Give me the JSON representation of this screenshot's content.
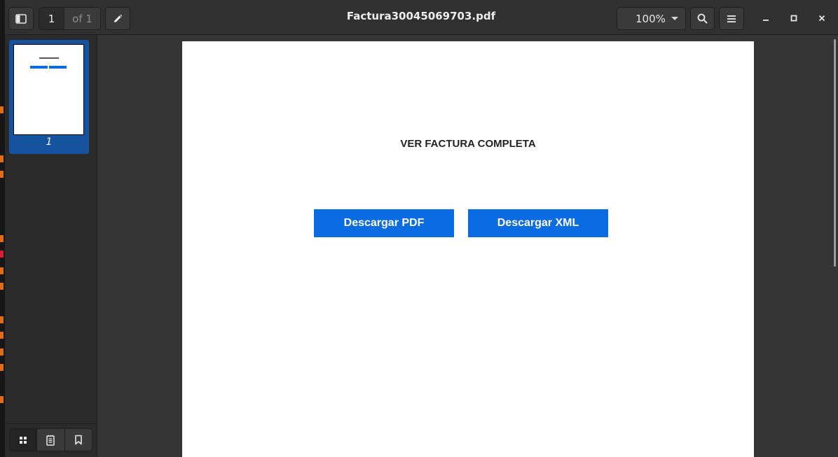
{
  "colors": {
    "accent": "#15539e",
    "pdf_button": "#0b6be0",
    "terminal_orange": "#e06c1a",
    "terminal_red": "#d11f3a"
  },
  "headerbar": {
    "title": "Factura30045069703.pdf",
    "page_current": "1",
    "page_total": "of 1",
    "zoom": "100%",
    "icons": {
      "sidebar_toggle": "sidebar-icon",
      "annotate": "pencil-icon",
      "zoom_caret": "chevron-down-icon",
      "search": "search-icon",
      "menu": "hamburger-icon",
      "minimize": "minimize-icon",
      "maximize": "maximize-icon",
      "close": "close-icon"
    }
  },
  "sidebar": {
    "thumbnails": [
      {
        "label": "1",
        "selected": true
      }
    ],
    "footer_icons": [
      "grid-icon",
      "document-list-icon",
      "bookmark-icon"
    ]
  },
  "document": {
    "heading": "VER FACTURA COMPLETA",
    "buttons": [
      {
        "label": "Descargar PDF"
      },
      {
        "label": "Descargar XML"
      }
    ]
  }
}
